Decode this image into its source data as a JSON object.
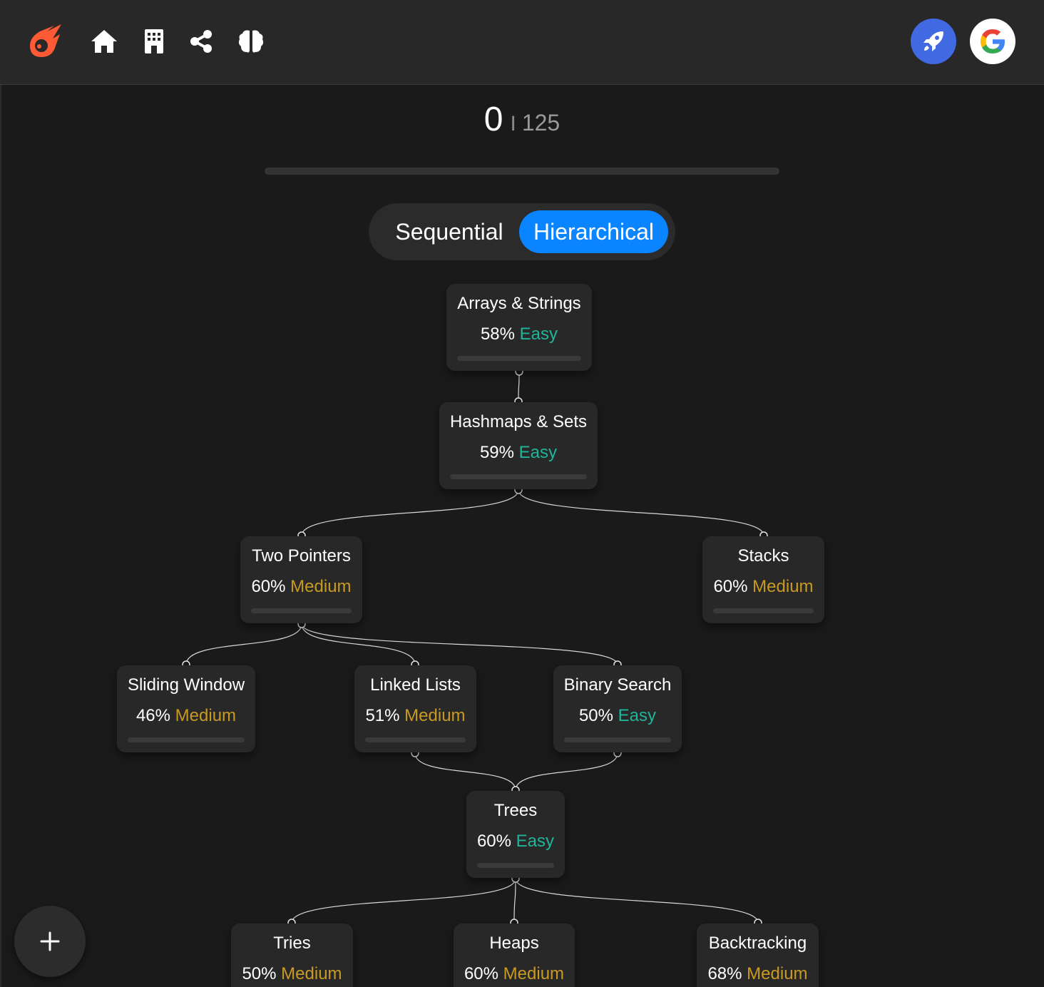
{
  "header": {
    "logo_icon": "meteor-logo-icon",
    "nav_icons": [
      "home-icon",
      "building-icon",
      "share-icon",
      "brain-icon"
    ],
    "right_buttons": [
      {
        "icon": "rocket-icon",
        "color": "#4169e1"
      },
      {
        "icon": "google-icon",
        "color": "#ffffff"
      }
    ]
  },
  "progress": {
    "solved": "0",
    "separator": "I",
    "total": "125",
    "fraction": 0
  },
  "view_toggle": {
    "options": [
      "Sequential",
      "Hierarchical"
    ],
    "selected": "Hierarchical",
    "accent": "#0a84ff"
  },
  "roadmap": {
    "nodes": [
      {
        "title": "Arrays & Strings",
        "percent": "58%",
        "difficulty": "Easy"
      },
      {
        "title": "Hashmaps & Sets",
        "percent": "59%",
        "difficulty": "Easy"
      },
      {
        "title": "Two Pointers",
        "percent": "60%",
        "difficulty": "Medium"
      },
      {
        "title": "Stacks",
        "percent": "60%",
        "difficulty": "Medium"
      },
      {
        "title": "Sliding Window",
        "percent": "46%",
        "difficulty": "Medium"
      },
      {
        "title": "Linked Lists",
        "percent": "51%",
        "difficulty": "Medium"
      },
      {
        "title": "Binary Search",
        "percent": "50%",
        "difficulty": "Easy"
      },
      {
        "title": "Trees",
        "percent": "60%",
        "difficulty": "Easy"
      },
      {
        "title": "Tries",
        "percent": "50%",
        "difficulty": "Medium"
      },
      {
        "title": "Heaps",
        "percent": "60%",
        "difficulty": "Medium"
      },
      {
        "title": "Backtracking",
        "percent": "68%",
        "difficulty": "Medium"
      }
    ],
    "edges": [
      [
        "Arrays & Strings",
        "Hashmaps & Sets"
      ],
      [
        "Hashmaps & Sets",
        "Two Pointers"
      ],
      [
        "Hashmaps & Sets",
        "Stacks"
      ],
      [
        "Two Pointers",
        "Sliding Window"
      ],
      [
        "Two Pointers",
        "Linked Lists"
      ],
      [
        "Two Pointers",
        "Binary Search"
      ],
      [
        "Linked Lists",
        "Trees"
      ],
      [
        "Binary Search",
        "Trees"
      ],
      [
        "Trees",
        "Tries"
      ],
      [
        "Trees",
        "Heaps"
      ],
      [
        "Trees",
        "Backtracking"
      ]
    ],
    "difficulty_colors": {
      "Easy": "#1fb59a",
      "Medium": "#c99a22"
    }
  },
  "fab": {
    "label": "+",
    "icon": "plus-icon"
  }
}
